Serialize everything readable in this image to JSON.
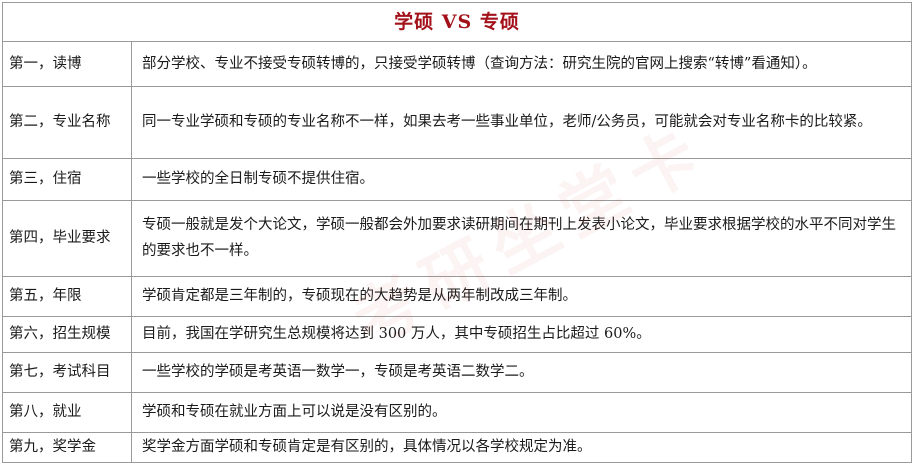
{
  "title": "学硕 VS 专硕",
  "rows": [
    {
      "label": "第一，读博",
      "content": "部分学校、专业不接受专硕转博的，只接受学硕转博（查询方法：研究生院的官网上搜索“转博”看通知）。"
    },
    {
      "label": "第二，专业名称",
      "content": "同一专业学硕和专硕的专业名称不一样，如果去考一些事业单位，老师/公务员，可能就会对专业名称卡的比较紧。"
    },
    {
      "label": "第三，住宿",
      "content": "一些学校的全日制专硕不提供住宿。"
    },
    {
      "label": "第四，毕业要求",
      "content": "专硕一般就是发个大论文，学硕一般都会外加要求读研期间在期刊上发表小论文，毕业要求根据学校的水平不同对学生的要求也不一样。"
    },
    {
      "label": "第五，年限",
      "content": "学硕肯定都是三年制的，专硕现在的大趋势是从两年制改成三年制。"
    },
    {
      "label": "第六，招生规模",
      "content": "目前，我国在学研究生总规模将达到 300 万人，其中专硕招生占比超过 60%。"
    },
    {
      "label": "第七，考试科目",
      "content": "一些学校的学硕是考英语一数学一，专硕是考英语二数学二。"
    },
    {
      "label": "第八，就业",
      "content": "学硕和专硕在就业方面上可以说是没有区别的。"
    },
    {
      "label": "第九，奖学金",
      "content": "奖学金方面学硕和专硕肯定是有区别的，具体情况以各学校规定为准。"
    }
  ],
  "watermark": "考研坐堂卡"
}
